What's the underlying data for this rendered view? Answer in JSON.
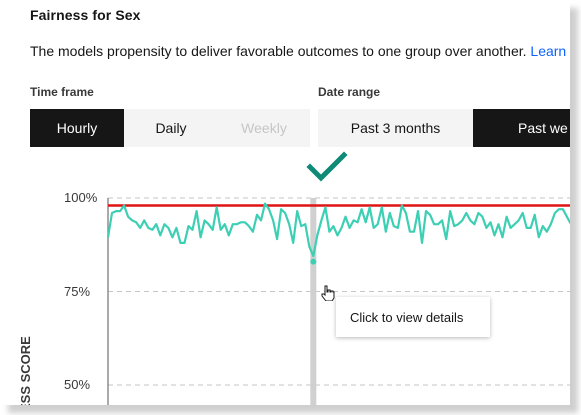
{
  "title": "Fairness for Sex",
  "description": {
    "text": "The models propensity to deliver favorable outcomes to one group over another.",
    "link": "Learn"
  },
  "time_frame": {
    "label": "Time frame",
    "options": [
      {
        "label": "Hourly",
        "state": "selected"
      },
      {
        "label": "Daily",
        "state": "normal"
      },
      {
        "label": "Weekly",
        "state": "disabled"
      }
    ]
  },
  "date_range": {
    "label": "Date range",
    "options": [
      {
        "label": "Past 3 months",
        "state": "normal"
      },
      {
        "label": "Past we",
        "state": "selected"
      }
    ]
  },
  "tooltip": "Click to view details",
  "colors": {
    "threshold": "#e01414",
    "series": "#3ccfb4",
    "check": "#0e8a77",
    "selected_bg": "#161616"
  },
  "icons": {
    "check": "checkmark-icon",
    "cursor": "hand-pointer-icon"
  },
  "chart_data": {
    "type": "line",
    "ylabel": "ESS SCORE",
    "y_ticks": [
      "100%",
      "75%",
      "50%"
    ],
    "ylim": [
      45,
      100
    ],
    "threshold": 98,
    "series": [
      {
        "values": [
          89.5,
          96,
          96.5,
          96.5,
          98,
          95,
          94,
          93.5,
          92,
          94,
          92,
          91.5,
          93,
          90,
          93,
          92,
          89.5,
          92,
          88,
          88,
          92.5,
          91.5,
          96.5,
          89.5,
          94,
          93,
          91.5,
          97.5,
          91.5,
          93,
          90,
          93,
          93,
          93.5,
          93.5,
          92.5,
          91,
          95.5,
          94,
          98.5,
          97,
          94,
          89,
          97,
          96,
          93,
          88,
          96.5,
          92.5,
          93,
          87,
          84.5,
          90,
          94,
          97.5,
          91,
          92.5,
          90,
          92,
          95,
          92,
          94,
          93.5,
          97,
          93.5,
          97.5,
          92,
          93,
          97.5,
          91,
          96,
          92.5,
          92,
          98,
          96,
          91,
          91,
          96.5,
          88,
          96.5,
          95.5,
          93,
          93,
          94,
          89,
          96.5,
          92.5,
          93,
          94,
          96,
          94,
          93,
          96,
          95,
          92,
          93.5,
          90,
          93,
          89.5,
          95,
          92,
          93,
          94,
          96,
          92,
          92,
          95.5,
          89.5,
          92.5,
          91,
          93,
          96,
          97,
          97,
          95,
          93,
          95
        ],
        "highlight_index": 51,
        "highlight_value": 83
      }
    ]
  }
}
